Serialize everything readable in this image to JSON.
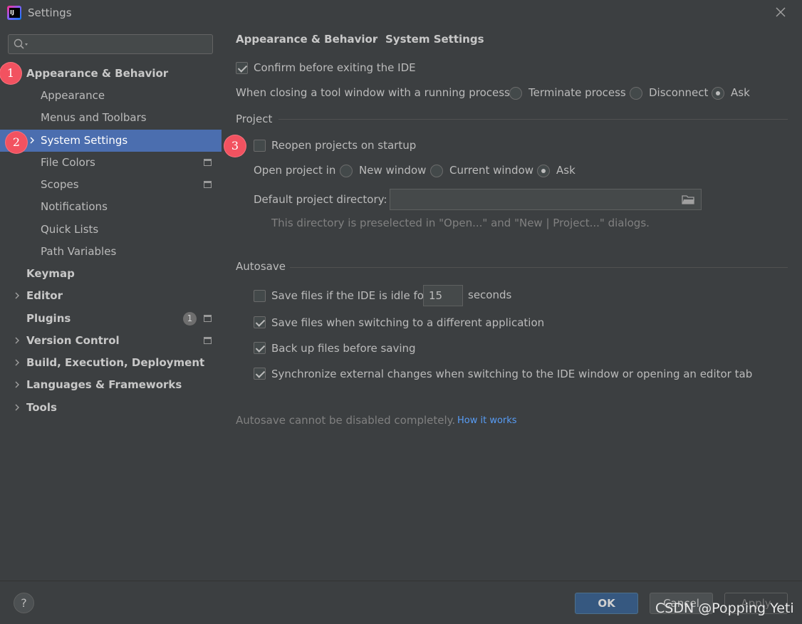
{
  "window": {
    "title": "Settings"
  },
  "sidebar": {
    "search_placeholder": "",
    "items": [
      {
        "label": "Appearance & Behavior",
        "marker": "1"
      },
      {
        "label": "Appearance"
      },
      {
        "label": "Menus and Toolbars"
      },
      {
        "label": "System Settings",
        "marker": "2"
      },
      {
        "label": "File Colors"
      },
      {
        "label": "Scopes"
      },
      {
        "label": "Notifications"
      },
      {
        "label": "Quick Lists"
      },
      {
        "label": "Path Variables"
      },
      {
        "label": "Keymap"
      },
      {
        "label": "Editor"
      },
      {
        "label": "Plugins",
        "badge": "1"
      },
      {
        "label": "Version Control"
      },
      {
        "label": "Build, Execution, Deployment"
      },
      {
        "label": "Languages & Frameworks"
      },
      {
        "label": "Tools"
      }
    ]
  },
  "breadcrumb": {
    "parent": "Appearance & Behavior",
    "separator": "›",
    "current": "System Settings"
  },
  "general": {
    "confirm_exit": {
      "label": "Confirm before exiting the IDE",
      "checked": true
    },
    "closing_label": "When closing a tool window with a running process:",
    "closing_options": [
      "Terminate process",
      "Disconnect",
      "Ask"
    ],
    "closing_selected": "Ask"
  },
  "project": {
    "section_title": "Project",
    "marker": "3",
    "reopen": {
      "label": "Reopen projects on startup",
      "checked": false
    },
    "open_in_label": "Open project in",
    "open_in_options": [
      "New window",
      "Current window",
      "Ask"
    ],
    "open_in_selected": "Ask",
    "default_dir_label": "Default project directory:",
    "default_dir_value": "",
    "default_dir_hint": "This directory is preselected in \"Open...\" and \"New | Project...\" dialogs."
  },
  "autosave": {
    "section_title": "Autosave",
    "idle_label": "Save files if the IDE is idle for",
    "idle_checked": false,
    "idle_value": "15",
    "idle_unit": "seconds",
    "switching": {
      "label": "Save files when switching to a different application",
      "checked": true
    },
    "backup": {
      "label": "Back up files before saving",
      "checked": true
    },
    "sync": {
      "label": "Synchronize external changes when switching to the IDE window or opening an editor tab",
      "checked": true
    },
    "note": "Autosave cannot be disabled completely.",
    "link": "How it works"
  },
  "buttons": {
    "help": "?",
    "ok": "OK",
    "cancel": "Cancel",
    "apply": "Apply"
  },
  "watermark": "CSDN @Popping Yeti",
  "colors": {
    "selection": "#4b6eaf",
    "marker": "#f25260",
    "link": "#589df6",
    "ok_button": "#365880"
  }
}
